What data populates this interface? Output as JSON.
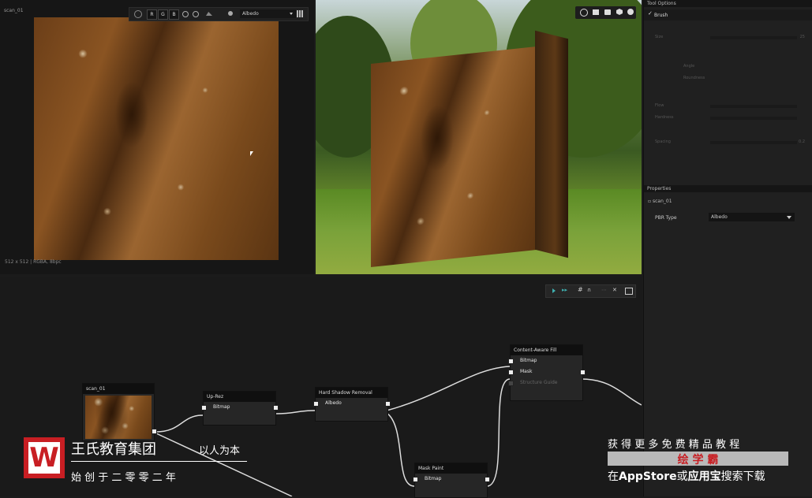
{
  "viewport2d": {
    "title": "scan_01",
    "status": "512 x 512 | RGBA, 8bpc",
    "channels": [
      "R",
      "G",
      "B"
    ],
    "channel_select": "Albedo"
  },
  "right": {
    "tool_options_header": "Tool Options",
    "brush_label": "Brush",
    "size_label": "Size",
    "size_value": "25",
    "angle_label": "Angle",
    "roundness_label": "Roundness",
    "flow_label": "Flow",
    "hardness_label": "Hardness",
    "spacing_label": "Spacing",
    "spacing_value": "0.2",
    "properties_header": "Properties",
    "properties_item": "scan_01",
    "pbr_label": "PBR Type",
    "pbr_value": "Albedo"
  },
  "graph": {
    "nodes": {
      "scan": {
        "title": "scan_01"
      },
      "uprez": {
        "title": "Up-Rez",
        "port": "Bitmap"
      },
      "hsr": {
        "title": "Hard Shadow Removal",
        "port": "Albedo"
      },
      "caf": {
        "title": "Content-Aware Fill",
        "ports": [
          "Bitmap",
          "Mask",
          "Structure Guide"
        ]
      },
      "mask": {
        "title": "Mask Paint",
        "port": "Bitmap"
      }
    }
  },
  "watermark": {
    "logo_letter": "W",
    "company": "王氏教育集团",
    "motto": "以人为本",
    "since": "始 创 于 二 零 零 二 年",
    "promo_line": "获 得 更 多 免 费 精 品 教 程",
    "app_name": "绘 学 霸",
    "store_prefix": "在",
    "store_name": "AppStore",
    "store_or": "或",
    "store_alt": "应用宝",
    "store_suffix": "搜索下载"
  },
  "colors": {
    "accent_teal": "#3fb0b0",
    "panel_bg": "#202020",
    "graph_bg": "#1a1a1a",
    "logo_red": "#c81e23"
  }
}
